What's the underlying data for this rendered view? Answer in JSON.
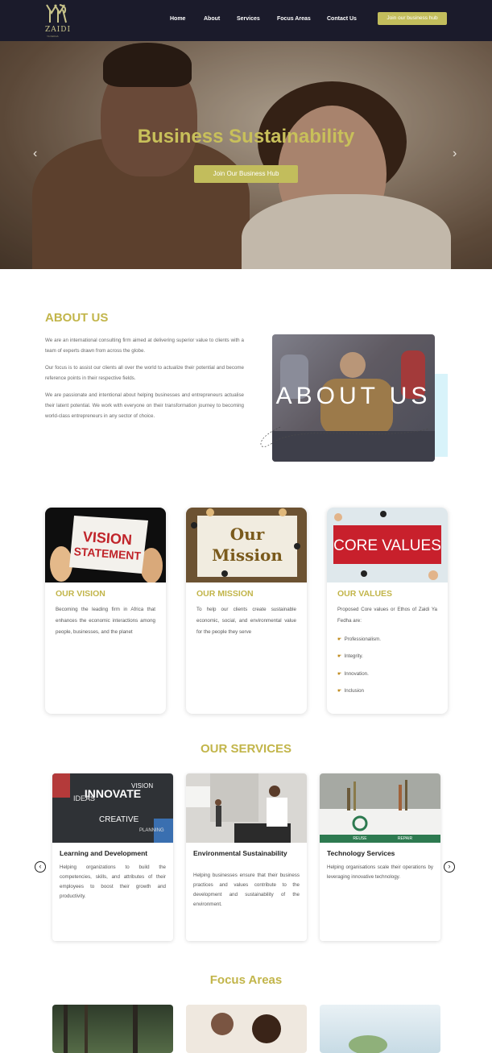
{
  "header": {
    "logo_word": "ZAIDI",
    "logo_sub": "YA FEDHA",
    "nav": [
      "Home",
      "About",
      "Services",
      "Focus Areas",
      "Contact Us"
    ],
    "cta": "Join our business hub"
  },
  "hero": {
    "title": "Business Sustainability",
    "button": "Join Our Business Hub",
    "prev": "‹",
    "next": "›"
  },
  "about": {
    "title": "ABOUT US",
    "paragraphs": [
      "We are an international consulting firm aimed at delivering superior value to clients with a team of experts drawn from across the globe.",
      "Our focus is to assist our clients all over the world to actualize their potential and become reference points in their respective fields.",
      "We are passionate and intentional about helping businesses and entrepreneurs actualise their latent potential. We work with everyone on their transformation journey to becoming world-class entrepreneurs in any sector of choice."
    ],
    "image_text": "ABOUT US"
  },
  "cards": [
    {
      "image_text": [
        "VISION",
        "STATEMENT"
      ],
      "title": "OUR VISION",
      "text": "Becoming the leading firm in Africa that enhances the economic interactions among people, businesses, and the planet"
    },
    {
      "image_text": [
        "Our",
        "Mission"
      ],
      "title": "OUR MISSION",
      "text": "To help our clients create sustainable economic, social, and environmental value for the people they serve"
    },
    {
      "image_text": [
        "CORE VALUES"
      ],
      "title": "OUR VALUES",
      "text": "Proposed Core values or Ethos of Zaidi Ya Fedha are:",
      "values": [
        "Professionalism.",
        "Integrity.",
        "Innovation.",
        "Inclusion"
      ]
    }
  ],
  "services": {
    "title": "OUR SERVICES",
    "items": [
      {
        "title": "Learning and Development",
        "text": "Helping organizations to build the competencies, skills, and attributes of their employees to boost their growth and productivity.",
        "image_words": [
          "INNOVATE",
          "IDEAS",
          "CREATIVE",
          "VISION",
          "PLANNING"
        ]
      },
      {
        "title": "Environmental Sustainability",
        "text": "Helping businesses ensure that their business practices and values contribute to the development and sustainability of the environment."
      },
      {
        "title": "Technology Services",
        "text": "Helping organisations scale their operations by leveraging innovative technology.",
        "image_words": [
          "REUSE",
          "REPAIR"
        ]
      }
    ],
    "prev": "‹",
    "next": "›"
  },
  "focus": {
    "title": "Focus Areas"
  },
  "colors": {
    "accent": "#c2bd5c",
    "heading": "#c2b54a",
    "header_bg": "#1b1b2b"
  }
}
